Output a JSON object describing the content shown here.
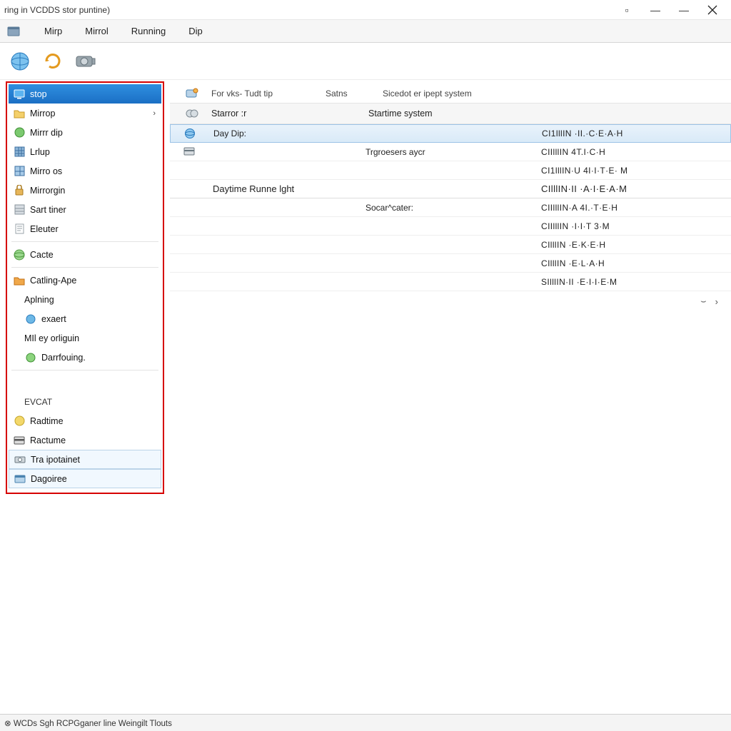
{
  "window": {
    "title": "ring in VCDDS stor puntine)"
  },
  "menu": {
    "items": [
      "Mirp",
      "Mirrol",
      "Running",
      "Dip"
    ]
  },
  "sidebar": {
    "items": [
      {
        "icon": "monitor-icon",
        "label": "stop",
        "selected": true
      },
      {
        "icon": "folder-icon",
        "label": "Mirrop",
        "chevron": true
      },
      {
        "icon": "disc-green-icon",
        "label": "Mirrr dip"
      },
      {
        "icon": "grid-icon",
        "label": "Lrlup"
      },
      {
        "icon": "grid-blue-icon",
        "label": "Mirro os"
      },
      {
        "icon": "lock-icon",
        "label": "Mirrorgin"
      },
      {
        "icon": "grid-gray-icon",
        "label": "Sart tiner"
      },
      {
        "icon": "doc-icon",
        "label": "Eleuter"
      }
    ],
    "group2": [
      {
        "icon": "globe-green-icon",
        "label": "Cacte"
      }
    ],
    "group3": [
      {
        "icon": "folder-orange-icon",
        "label": "Catling-Ape"
      },
      {
        "icon": "",
        "label": "Aplning",
        "indent": true
      },
      {
        "icon": "globe-blue-icon",
        "label": "exaert",
        "indent": true
      },
      {
        "icon": "",
        "label": "MIl ey orliguin",
        "indent": true
      },
      {
        "icon": "disc-green2-icon",
        "label": "Darrfouing.",
        "indent": true
      }
    ],
    "group4_header": "EVCAT",
    "group4": [
      {
        "icon": "globe-yellow-icon",
        "label": "Radtime"
      },
      {
        "icon": "card-icon",
        "label": "Ractume"
      },
      {
        "icon": "drive-icon",
        "label": "Tra ipotainet",
        "boxed": true
      },
      {
        "icon": "panel-icon",
        "label": "Dagoiree",
        "boxed": true
      }
    ]
  },
  "main": {
    "columns": {
      "c1": "For vks- Tudt tip",
      "c2": "Satns",
      "c3": "Sicedot er ipept system"
    },
    "subheader": {
      "left": "Starror :r",
      "right": "Startime system"
    },
    "rows": [
      {
        "icon": "globe-small-icon",
        "name": "Day Dip:",
        "desc": "",
        "code": "CI1lllIN ·II.·C·E·A·H",
        "sel": true
      },
      {
        "icon": "card-small-icon",
        "name": "",
        "desc": "Trgroesers aycr",
        "code": "CIIlllIN 4T.I·C·H"
      },
      {
        "name": "",
        "desc": "",
        "code": "CI1lllIN·U 4I·I·T·E· M"
      },
      {
        "section": "Daytime Runne lght",
        "code": "CIlllIN·II ·A·I·E·A·M"
      },
      {
        "name": "",
        "desc": "Socar^cater:",
        "code": "CIIlllIN·A 4I.·T·E·H"
      },
      {
        "name": "",
        "desc": "",
        "code": "CIIlllIN ·I·I·T 3·M"
      },
      {
        "name": "",
        "desc": "",
        "code": "CIlllIN ·E·K·E·H"
      },
      {
        "name": "",
        "desc": "",
        "code": "CIlllIN ·E·L·A·H"
      },
      {
        "name": "",
        "desc": "",
        "code": "SIlllIN·II ·E·I·I·E·M"
      }
    ]
  },
  "statusbar": "⊗ WCDs Sgh RCPGganer line Weingilt Tlouts"
}
